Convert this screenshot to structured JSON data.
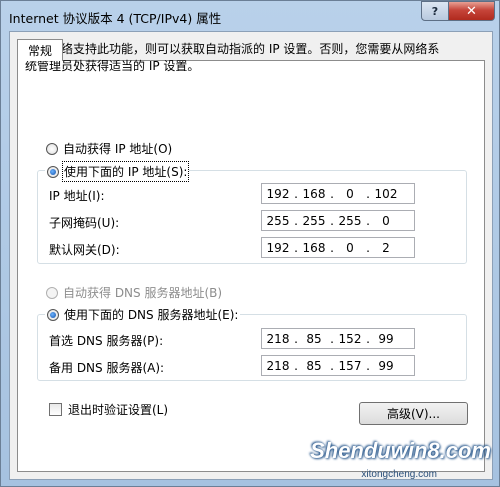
{
  "window": {
    "title": "Internet 协议版本 4 (TCP/IPv4) 属性",
    "help_label": "?",
    "close_label": "✕"
  },
  "tab": {
    "label": "常规"
  },
  "description": "如果网络支持此功能，则可以获取自动指派的 IP 设置。否则，您需要从网络系统管理员处获得适当的 IP 设置。",
  "ip_section": {
    "auto_label": "自动获得 IP 地址(O)",
    "manual_label": "使用下面的 IP 地址(S):",
    "fields": [
      {
        "label": "IP 地址(I):",
        "octets": [
          "192",
          "168",
          "0",
          "102"
        ]
      },
      {
        "label": "子网掩码(U):",
        "octets": [
          "255",
          "255",
          "255",
          "0"
        ]
      },
      {
        "label": "默认网关(D):",
        "octets": [
          "192",
          "168",
          "0",
          "2"
        ]
      }
    ]
  },
  "dns_section": {
    "auto_label": "自动获得 DNS 服务器地址(B)",
    "manual_label": "使用下面的 DNS 服务器地址(E):",
    "fields": [
      {
        "label": "首选 DNS 服务器(P):",
        "octets": [
          "218",
          "85",
          "152",
          "99"
        ]
      },
      {
        "label": "备用 DNS 服务器(A):",
        "octets": [
          "218",
          "85",
          "157",
          "99"
        ]
      }
    ]
  },
  "validate_label": "退出时验证设置(L)",
  "advanced_label": "高级(V)...",
  "watermark": {
    "brand": "Shenduwin8.com",
    "domain": "xitongcheng.com"
  }
}
